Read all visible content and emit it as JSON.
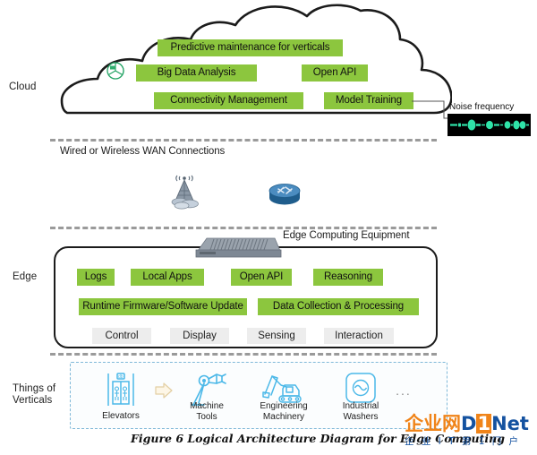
{
  "figure": {
    "caption": "Figure 6 Logical Architecture Diagram for Edge Computing"
  },
  "tiers": {
    "cloud_label": "Cloud",
    "edge_label": "Edge",
    "things_label_line1": "Things of",
    "things_label_line2": "Verticals"
  },
  "cloud": {
    "icon_name": "pie-chart-icon",
    "services": [
      {
        "label": "Predictive maintenance for verticals"
      },
      {
        "label": "Big Data Analysis"
      },
      {
        "label": "Open API"
      },
      {
        "label": "Connectivity Management"
      },
      {
        "label": "Model Training"
      }
    ]
  },
  "noise": {
    "label": "Noise frequency",
    "waveform_color": "#2fe3a8",
    "background_color": "#000000"
  },
  "wan": {
    "label": "Wired or Wireless WAN Connections",
    "devices": [
      {
        "name": "cell-tower-icon"
      },
      {
        "name": "router-icon"
      }
    ]
  },
  "edge": {
    "equipment_label": "Edge Computing Equipment",
    "equipment_icon": "edge-appliance-icon",
    "row1": [
      {
        "label": "Logs"
      },
      {
        "label": "Local Apps"
      },
      {
        "label": "Open API"
      },
      {
        "label": "Reasoning"
      }
    ],
    "row2": [
      {
        "label": "Runtime Firmware/Software Update"
      },
      {
        "label": "Data Collection & Processing"
      }
    ],
    "row3": [
      {
        "label": "Control"
      },
      {
        "label": "Display"
      },
      {
        "label": "Sensing"
      },
      {
        "label": "Interaction"
      }
    ]
  },
  "things": {
    "items": [
      {
        "label_line1": "Elevators",
        "label_line2": "",
        "icon": "elevator-icon"
      },
      {
        "label_line1": "Machine",
        "label_line2": "Tools",
        "icon": "robot-arm-icon"
      },
      {
        "label_line1": "Engineering",
        "label_line2": "Machinery",
        "icon": "excavator-icon"
      },
      {
        "label_line1": "Industrial",
        "label_line2": "Washers",
        "icon": "washer-icon"
      }
    ],
    "ellipsis": "...",
    "arrow_icon": "right-arrow-icon"
  },
  "watermark": {
    "cn_brand": "企业网",
    "d": "D",
    "one": "1",
    "net": "Net",
    "sub": "企 业 I T 第 1 门 户"
  },
  "colors": {
    "chip_green": "#8CC63E",
    "chip_gray": "#ededed",
    "outline": "#1b1b1b",
    "things_border": "#7fb8d8",
    "icon_blue": "#4BB8E8"
  }
}
